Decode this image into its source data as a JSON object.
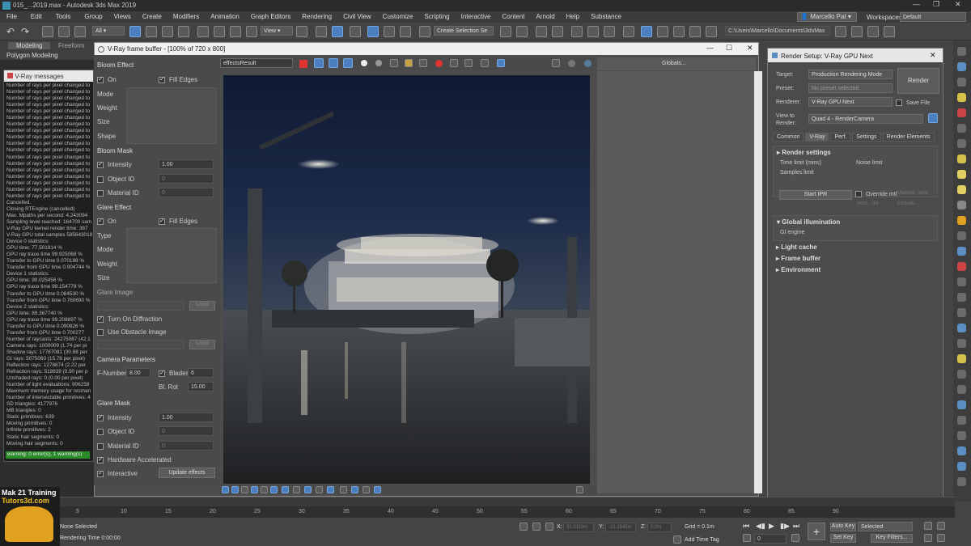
{
  "title_bar": {
    "file": "015_...2019.max - Autodesk 3ds Max 2019"
  },
  "menu": [
    "File",
    "Edit",
    "Tools",
    "Group",
    "Views",
    "Create",
    "Modifiers",
    "Animation",
    "Graph Editors",
    "Rendering",
    "Civil View",
    "Customize",
    "Scripting",
    "Interactive",
    "Content",
    "Arnold",
    "Help",
    "Substance"
  ],
  "user": "Marcello Pat",
  "workspace_label": "Workspaces:",
  "workspace_value": "Default",
  "toolbar": {
    "filter": "All",
    "view": "View",
    "selection_set": "Create Selection Se",
    "path": "C:\\Users\\Marcello\\Documents\\3dsMax"
  },
  "ribbon_tabs": [
    "Modeling",
    "Freeform"
  ],
  "ribbon_sub": "Polygon Modeling",
  "vray_messages": {
    "title": "V-Ray messages",
    "lines": [
      "Number of rays per pixel changed to",
      "Number of rays per pixel changed to",
      "Number of rays per pixel changed to",
      "Number of rays per pixel changed to",
      "Number of rays per pixel changed to",
      "Number of rays per pixel changed to",
      "Number of rays per pixel changed to",
      "Number of rays per pixel changed to",
      "Number of rays per pixel changed to",
      "Number of rays per pixel changed to",
      "Number of rays per pixel changed to",
      "Number of rays per pixel changed to",
      "Number of rays per pixel changed to",
      "Number of rays per pixel changed to",
      "Number of rays per pixel changed to",
      "Number of rays per pixel changed to",
      "Number of rays per pixel changed to",
      "Number of rays per pixel changed to",
      "Cancelled.",
      "Closing RTEngine (cancelled)",
      "Max. Mpaths per second: 4,243094",
      "Sampling level reached: 164700 sam",
      "V-Ray GPU kernel render time: 387",
      "V-Ray GPU total samples 585643018",
      "Device 0 statistics:",
      "  GPU time: 77.501914 %",
      "  GPU ray trace time 99.925068 %",
      "  Transfer to GPU time 0.070188 %",
      "  Transfer from GPU time 0.004744 %",
      "Device 1 statistics:",
      "  GPU time: 90.025456 %",
      "  GPU ray trace time 99.154779 %",
      "  Transfer to GPU time 0.084530 %",
      "  Transfer from GPU time 0.760690 %",
      "Device 2 statistics:",
      "  GPU time: 89.367740 %",
      "  GPU ray trace time 99.208897 %",
      "  Transfer to GPU time 0.090826 %",
      "  Transfer from GPU time 0.700277",
      "Number of raycasts: 24275087 (42.1",
      "  Camera rays: 1000009 (1.74 per pi",
      "  Shadow rays: 17787081 (30.88 per",
      "  GI rays: 5075060 (15.76 per pixel)",
      "  Reflection rays: 1278874 (2.22 per",
      "  Refraction rays: 519839 (0.90 per p",
      "  Unshaded rays: 0 (0.00 per pixel)",
      "Number of light evaluations: 906258",
      "Maximum memory usage for resman",
      "Number of intersectable primitives: 4",
      "  SD triangles: 4177976",
      "  MB triangles: 0",
      "  Static primitives: 639",
      "  Moving primitives: 0",
      "  Infinite primitives: 2",
      "  Static hair segments: 0",
      "  Moving hair segments: 0"
    ],
    "warning": "warning: 0 error(s), 1 warning(s)"
  },
  "frame_buffer": {
    "title": "V-Ray frame buffer - [100% of 720 x 800]",
    "channel": "effectsResult",
    "globals": "Globals..."
  },
  "lens": {
    "bloom_effect": "Bloom Effect",
    "on": "On",
    "fill_edges": "Fill Edges",
    "mode": "Mode",
    "weight": "Weight",
    "size": "Size",
    "shape": "Shape",
    "bloom_mask": "Bloom Mask",
    "intensity": "Intensity",
    "intensity_val": "1.00",
    "object_id": "Object ID",
    "object_id_val": "0",
    "material_id": "Material ID",
    "material_id_val": "0",
    "glare_effect": "Glare Effect",
    "type": "Type",
    "glare_image": "Glare Image",
    "load": "Load",
    "turn_on_diffraction": "Turn On Diffraction",
    "use_obstacle_image": "Use Obstacle Image",
    "camera_params": "Camera Parameters",
    "f_number": "F-Number",
    "f_number_val": "8.00",
    "blades": "Blades",
    "blades_val": "6",
    "bl_rot": "Bl. Rot",
    "bl_rot_val": "15.00",
    "glare_mask": "Glare Mask",
    "hardware_accel": "Hardware Accelerated",
    "interactive": "Interactive",
    "update_effects": "Update effects"
  },
  "render_setup": {
    "title": "Render Setup: V-Ray GPU Next",
    "target_lbl": "Target:",
    "target": "Production Rendering Mode",
    "preset_lbl": "Preset:",
    "preset": "No preset selected",
    "renderer_lbl": "Renderer:",
    "renderer": "V-Ray GPU Next",
    "save_file": "Save File",
    "view_lbl": "View to Render:",
    "view": "Quad 4 - RenderCamera",
    "render_btn": "Render",
    "tabs": [
      "Common",
      "V-Ray",
      "Perf.",
      "Settings",
      "Render Elements"
    ],
    "render_settings": "Render settings",
    "time_limit": "Time limit (mins)",
    "noise_limit": "Noise limit",
    "samples_limit": "Samples limit",
    "start_ipr": "Start IPR",
    "override_mtl": "Override mtl",
    "material_none": "Material: none",
    "include": "Inclu... list",
    "exclude": "Exclude...",
    "gi": "Global illumination",
    "gi_engine": "GI engine",
    "light_cache": "Light cache",
    "frame_buffer": "Frame buffer",
    "environment": "Environment"
  },
  "timeline": {
    "ticks": [
      "5",
      "10",
      "15",
      "20",
      "25",
      "30",
      "35",
      "40",
      "45",
      "50",
      "55",
      "60",
      "65",
      "70",
      "75",
      "80",
      "85",
      "90"
    ]
  },
  "status": {
    "selected": "None Selected",
    "rendering_time": "Rendering Time  0:00:00",
    "x_lbl": "X:",
    "x_val": "91.0119m",
    "y_lbl": "Y:",
    "y_val": "-21.1545m",
    "z_lbl": "Z:",
    "z_val": "0.0m",
    "grid": "Grid = 0.1m",
    "add_time_tag": "Add Time Tag",
    "auto_key": "Auto Key",
    "selected_dd": "Selected",
    "set_key": "Set Key",
    "key_filters": "Key Filters...",
    "frame": "0"
  },
  "watermark": {
    "line1": "Mak 21 Training",
    "line2": "Tutors3d.com"
  }
}
